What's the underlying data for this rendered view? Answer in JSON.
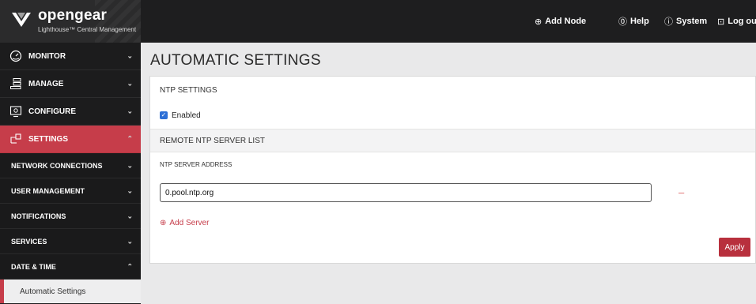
{
  "brand": {
    "name": "opengear",
    "subtitle": "Lighthouse™ Central Management"
  },
  "topnav": {
    "add_node": "Add Node",
    "help": "Help",
    "system": "System",
    "logout": "Log out"
  },
  "sidebar": {
    "main": [
      {
        "label": "MONITOR",
        "icon": "gauge-icon"
      },
      {
        "label": "MANAGE",
        "icon": "stack-icon"
      },
      {
        "label": "CONFIGURE",
        "icon": "monitor-gear-icon"
      },
      {
        "label": "SETTINGS",
        "icon": "network-icon"
      }
    ],
    "sub": [
      {
        "label": "NETWORK CONNECTIONS"
      },
      {
        "label": "USER MANAGEMENT"
      },
      {
        "label": "NOTIFICATIONS"
      },
      {
        "label": "SERVICES"
      },
      {
        "label": "DATE & TIME"
      }
    ],
    "active_leaf": "Automatic Settings"
  },
  "page": {
    "title": "AUTOMATIC SETTINGS"
  },
  "ntp": {
    "section_title": "NTP SETTINGS",
    "enabled_label": "Enabled",
    "enabled": true,
    "server_list_title": "REMOTE NTP SERVER LIST",
    "server_address_label": "NTP SERVER ADDRESS",
    "server_value": "0.pool.ntp.org",
    "remove_symbol": "–",
    "add_server_label": "Add Server",
    "apply_label": "Apply"
  },
  "colors": {
    "accent": "#c63d4a",
    "topbar": "#1e1e1f",
    "sidebar": "#1c1c1d",
    "checkbox": "#2d6fd6"
  }
}
